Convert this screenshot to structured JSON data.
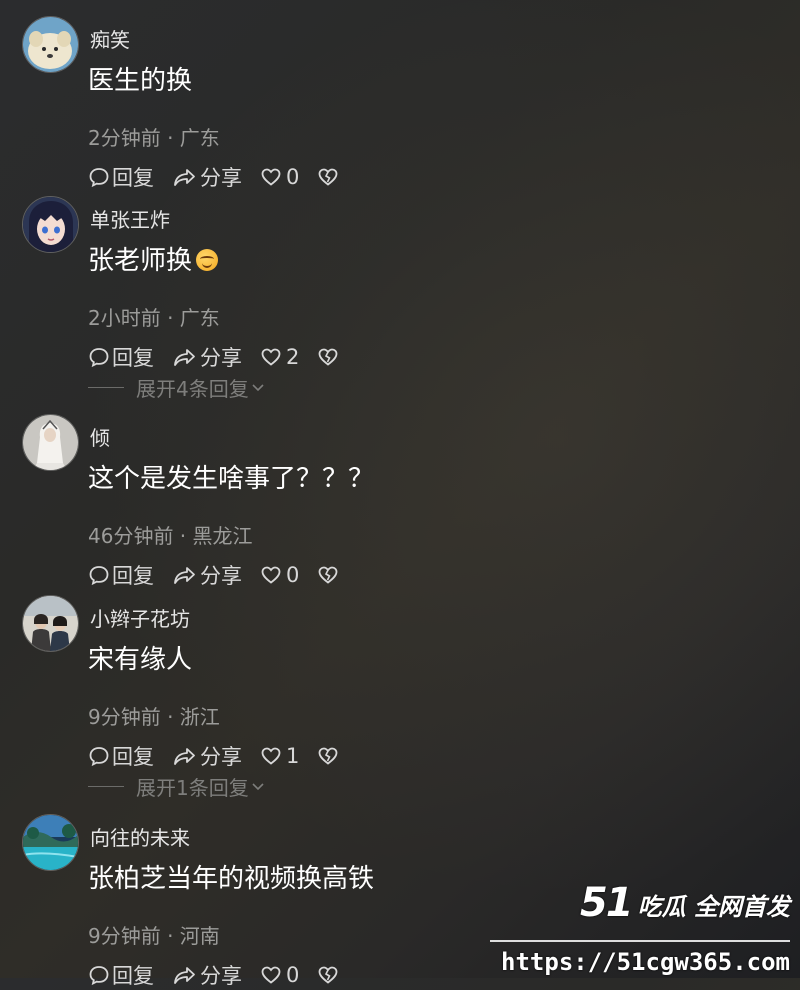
{
  "comments": [
    {
      "username": "痴笑",
      "text": "医生的换",
      "emoji": false,
      "meta": "2分钟前 · 广东",
      "reply_label": "回复",
      "share_label": "分享",
      "likes": "0",
      "expand": null
    },
    {
      "username": "单张王炸",
      "text": "张老师换",
      "emoji": true,
      "meta": "2小时前 · 广东",
      "reply_label": "回复",
      "share_label": "分享",
      "likes": "2",
      "expand": "展开4条回复"
    },
    {
      "username": "倾",
      "text": "这个是发生啥事了？？？",
      "emoji": false,
      "meta": "46分钟前 · 黑龙江",
      "reply_label": "回复",
      "share_label": "分享",
      "likes": "0",
      "expand": null
    },
    {
      "username": "小辫子花坊",
      "text": "宋有缘人",
      "emoji": false,
      "meta": "9分钟前 · 浙江",
      "reply_label": "回复",
      "share_label": "分享",
      "likes": "1",
      "expand": "展开1条回复"
    },
    {
      "username": "向往的未来",
      "text": "张柏芝当年的视频换高铁",
      "emoji": false,
      "meta": "9分钟前 · 河南",
      "reply_label": "回复",
      "share_label": "分享",
      "likes": "0",
      "expand": null
    }
  ],
  "watermark": {
    "number": "51",
    "tag": "吃瓜 全网首发",
    "url": "https://51cgw365.com"
  },
  "icons": {
    "reply": "comment-bubble-icon",
    "share": "share-arrow-icon",
    "like": "heart-icon",
    "dislike": "broken-heart-icon",
    "expand": "chevron-down-icon"
  }
}
